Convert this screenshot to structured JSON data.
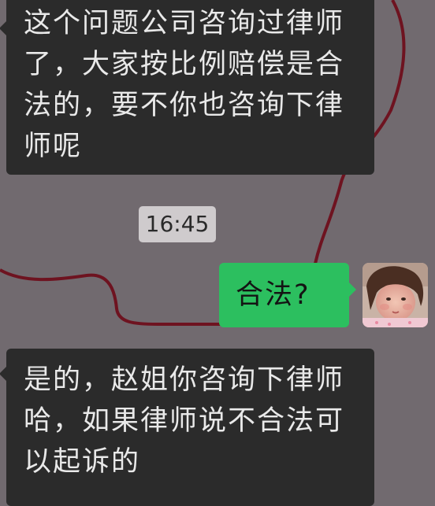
{
  "chat": {
    "background_color": "#716a6f",
    "messages": [
      {
        "sender": "other",
        "lines": [
          "这个问题公司咨询过律师",
          "了，大家按比例赔偿是合",
          "法的，要不你也咨询下律",
          "师呢"
        ]
      },
      {
        "sender": "self",
        "text": "合法?"
      },
      {
        "sender": "other",
        "lines": [
          "是的，赵姐你咨询下律师",
          "哈，如果律师说不合法可",
          "以起诉的"
        ]
      }
    ],
    "timestamp": "16:45",
    "self_avatar_icon": "child-photo-avatar",
    "colors": {
      "incoming_bubble": "#2b2b2b",
      "outgoing_bubble": "#2cbf5f",
      "timestamp_pill": "#cfcbcd",
      "doodle": "#6e1320"
    }
  }
}
